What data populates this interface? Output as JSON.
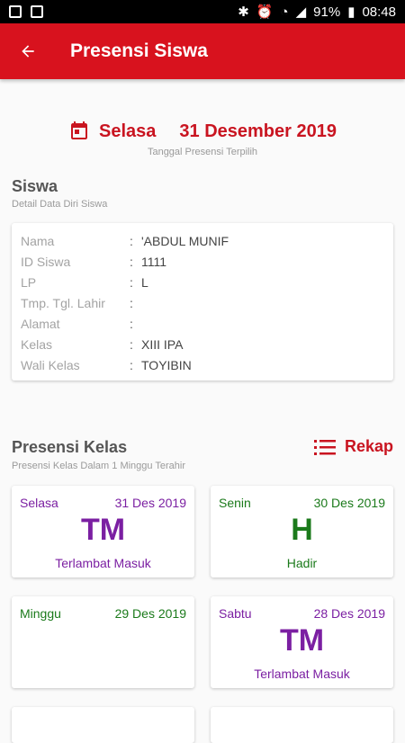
{
  "status_bar": {
    "battery": "91%",
    "time": "08:48"
  },
  "app_bar": {
    "title": "Presensi Siswa"
  },
  "selected_date": {
    "day": "Selasa",
    "date": "31 Desember 2019",
    "caption": "Tanggal Presensi Terpilih"
  },
  "student": {
    "title": "Siswa",
    "subtitle": "Detail Data Diri Siswa",
    "fields": [
      {
        "label": "Nama",
        "value": "'ABDUL MUNIF"
      },
      {
        "label": "ID Siswa",
        "value": "1111"
      },
      {
        "label": "LP",
        "value": "L"
      },
      {
        "label": "Tmp. Tgl. Lahir",
        "value": ""
      },
      {
        "label": "Alamat",
        "value": ""
      },
      {
        "label": "Kelas",
        "value": "XIII IPA"
      },
      {
        "label": "Wali Kelas",
        "value": "TOYIBIN"
      }
    ]
  },
  "attendance": {
    "title": "Presensi Kelas",
    "subtitle": "Presensi Kelas Dalam 1 Minggu Terahir",
    "rekap_label": "Rekap",
    "cards": [
      {
        "day": "Selasa",
        "date": "31 Des 2019",
        "code": "TM",
        "status": "Terlambat Masuk",
        "color": "#7b1fa2"
      },
      {
        "day": "Senin",
        "date": "30 Des 2019",
        "code": "H",
        "status": "Hadir",
        "color": "#1b7a1b"
      },
      {
        "day": "Minggu",
        "date": "29 Des 2019",
        "code": "",
        "status": "",
        "color": "#1b7a1b"
      },
      {
        "day": "Sabtu",
        "date": "28 Des 2019",
        "code": "TM",
        "status": "Terlambat Masuk",
        "color": "#7b1fa2"
      }
    ]
  },
  "colors": {
    "primary": "#d8121e",
    "accent": "#c91420",
    "late": "#7b1fa2",
    "present": "#1b7a1b"
  }
}
